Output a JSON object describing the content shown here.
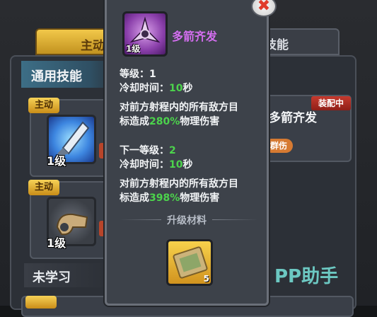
{
  "tabs": {
    "left_label": "主动",
    "right_label": "技能"
  },
  "sections": {
    "general": "通用技能",
    "unlearned": "未学习"
  },
  "skill_list": [
    {
      "tag": "主动",
      "level": "1级",
      "icon": "arrowhead-icon"
    },
    {
      "tag": "主动",
      "level": "1级",
      "icon": "whistle-icon"
    }
  ],
  "right_card": {
    "badge": "装配中",
    "name": "多箭齐发",
    "group_badge": "群伤"
  },
  "popup": {
    "icon_level": "1级",
    "skill_name": "多箭齐发",
    "current": {
      "level_label": "等级：",
      "level_value": "1",
      "cooldown_label": "冷却时间：",
      "cooldown_value": "10",
      "cooldown_unit": "秒",
      "desc_line1": "对前方射程内的所有敌方目",
      "desc_line2_prefix": "标造成",
      "desc_percent": "280%",
      "desc_line2_suffix": "物理伤害"
    },
    "next": {
      "level_label": "下一等级：",
      "level_value": "2",
      "cooldown_label": "冷却时间：",
      "cooldown_value": "10",
      "cooldown_unit": "秒",
      "desc_line1": "对前方射程内的所有敌方目",
      "desc_line2_prefix": "标造成",
      "desc_percent": "398%",
      "desc_line2_suffix": "物理伤害"
    },
    "upgrade_label": "升级材料",
    "material": {
      "icon": "scroll-map-icon",
      "count": "5"
    },
    "close_icon": "close-x-icon"
  },
  "watermark": "PP助手",
  "colors": {
    "highlight_green": "#4cd34c",
    "skill_name_purple": "#d46ef0",
    "tab_gold": "#f2c84a"
  }
}
